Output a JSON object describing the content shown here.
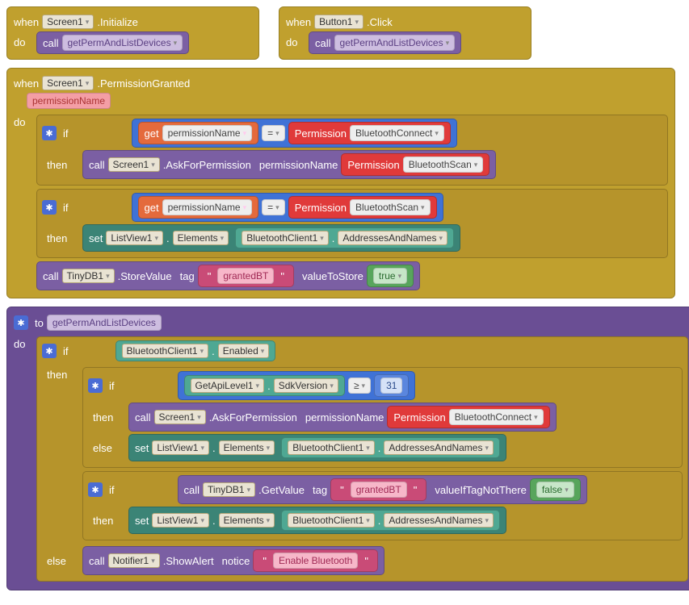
{
  "kw": {
    "when": "when",
    "do": "do",
    "call": "call",
    "if": "if",
    "then": "then",
    "else": "else",
    "to": "to",
    "set": "set",
    "get": "get",
    "tag": "tag",
    "notice": "notice",
    "valueToStore": "valueToStore",
    "valueIfTagNotThere": "valueIfTagNotThere",
    "permissionNameArg": "permissionName"
  },
  "dot": " .",
  "comps": {
    "screen1": "Screen1",
    "button1": "Button1",
    "listview1": "ListView1",
    "btclient": "BluetoothClient1",
    "tinydb": "TinyDB1",
    "notifier": "Notifier1",
    "getapi": "GetApiLevel1"
  },
  "events": {
    "initialize": "Initialize",
    "click": "Click",
    "permGranted": "PermissionGranted"
  },
  "procs": {
    "getPerm": "getPermAndListDevices"
  },
  "methods": {
    "askForPermission": "AskForPermission",
    "storeValue": "StoreValue",
    "getValue": "GetValue",
    "showAlert": "ShowAlert"
  },
  "props": {
    "elements": "Elements",
    "addrNames": "AddressesAndNames",
    "enabled": "Enabled",
    "sdkVersion": "SdkVersion"
  },
  "vars": {
    "permissionName": "permissionName"
  },
  "perm": {
    "label": "Permission",
    "btConnect": "BluetoothConnect",
    "btScan": "BluetoothScan"
  },
  "ops": {
    "eq": "=",
    "ge": "≥"
  },
  "nums": {
    "apiLevel": "31"
  },
  "strings": {
    "grantedBT": "grantedBT",
    "enableBT": "Enable Bluetooth"
  },
  "bools": {
    "true": "true",
    "false": "false"
  },
  "to_kw": "to"
}
